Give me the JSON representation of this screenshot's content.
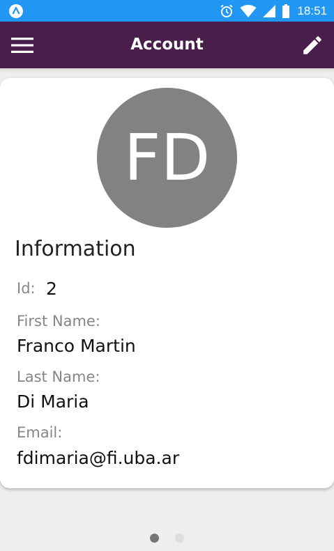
{
  "status_bar": {
    "time": "18:51",
    "icons": [
      "app-notification-icon",
      "alarm-icon",
      "wifi-icon",
      "signal-icon",
      "battery-icon"
    ],
    "background_color": "#2196f3"
  },
  "app_bar": {
    "title": "Account",
    "left_icon": "menu-icon",
    "right_icon": "edit-icon",
    "background_color": "#4a1e4b"
  },
  "profile": {
    "initials": "FD",
    "avatar_color": "#828282"
  },
  "information": {
    "title": "Information",
    "id_label": "Id:",
    "id_value": "2",
    "first_name_label": "First Name:",
    "first_name_value": "Franco Martin",
    "last_name_label": "Last Name:",
    "last_name_value": "Di Maria",
    "email_label": "Email:",
    "email_value": "fdimaria@fi.uba.ar"
  },
  "pager": {
    "page_count": 2,
    "current_page": 1,
    "active_color": "#757575",
    "inactive_color": "#dddddd"
  }
}
